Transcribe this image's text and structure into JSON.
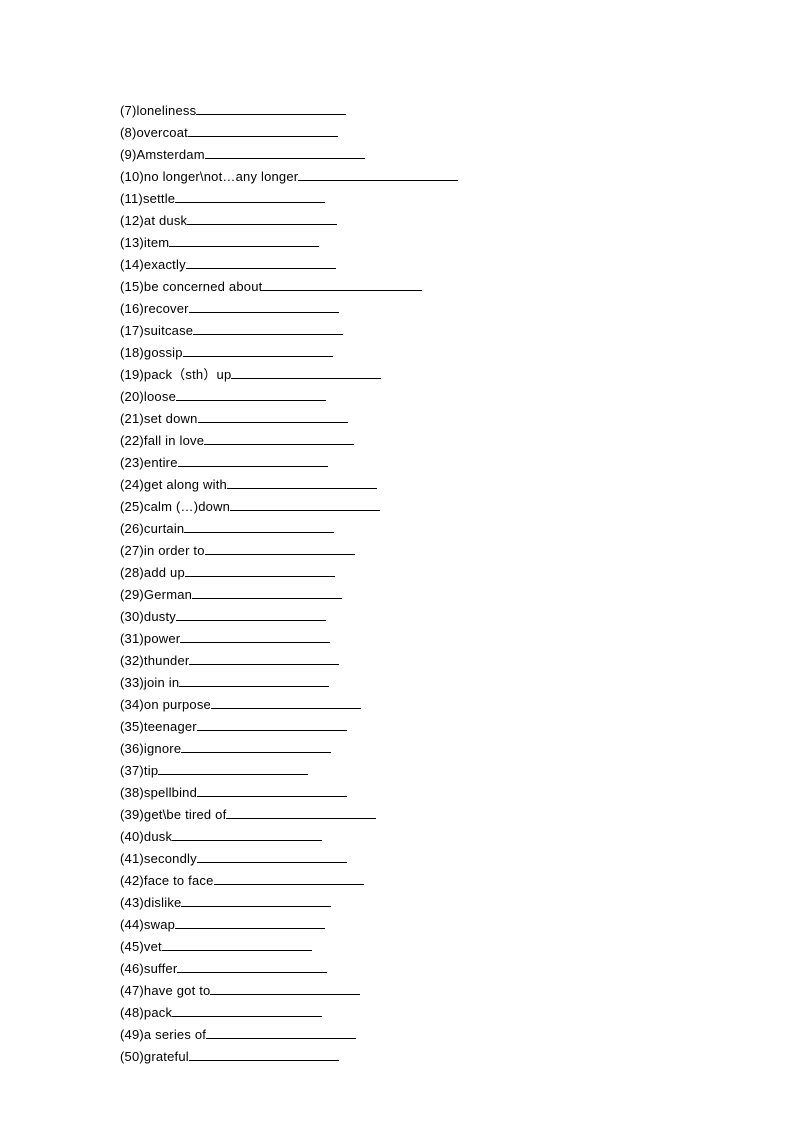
{
  "items": [
    {
      "num": "7",
      "word": "loneliness",
      "blank": "w-med"
    },
    {
      "num": "8",
      "word": "overcoat",
      "blank": "w-med"
    },
    {
      "num": "9",
      "word": "Amsterdam",
      "blank": "w-long"
    },
    {
      "num": "10",
      "word": "no longer\\not…any longer",
      "blank": "w-long"
    },
    {
      "num": "11",
      "word": "settle",
      "blank": "w-med"
    },
    {
      "num": "12",
      "word": "at dusk",
      "blank": "w-med"
    },
    {
      "num": "13",
      "word": "item",
      "blank": "w-med"
    },
    {
      "num": "14",
      "word": "exactly",
      "blank": "w-med"
    },
    {
      "num": "15",
      "word": "be concerned about",
      "blank": "w-long"
    },
    {
      "num": "16",
      "word": "recover",
      "blank": "w-med"
    },
    {
      "num": "17",
      "word": "suitcase",
      "blank": "w-med"
    },
    {
      "num": "18",
      "word": "gossip",
      "blank": "w-med"
    },
    {
      "num": "19",
      "word": "pack（sth）up",
      "blank": "w-med"
    },
    {
      "num": "20",
      "word": "loose",
      "blank": "w-med"
    },
    {
      "num": "21",
      "word": "set down",
      "blank": "w-med"
    },
    {
      "num": "22",
      "word": "fall in love",
      "blank": "w-med"
    },
    {
      "num": "23",
      "word": "entire",
      "blank": "w-med"
    },
    {
      "num": "24",
      "word": "get along with",
      "blank": "w-med"
    },
    {
      "num": "25",
      "word": "calm (…)down",
      "blank": "w-med"
    },
    {
      "num": "26",
      "word": "curtain",
      "blank": "w-med"
    },
    {
      "num": "27",
      "word": "in order to",
      "blank": "w-med"
    },
    {
      "num": "28",
      "word": "add up",
      "blank": "w-med"
    },
    {
      "num": "29",
      "word": "German",
      "blank": "w-med"
    },
    {
      "num": "30",
      "word": "dusty",
      "blank": "w-med"
    },
    {
      "num": "31",
      "word": "power",
      "blank": "w-med"
    },
    {
      "num": "32",
      "word": "thunder",
      "blank": "w-med"
    },
    {
      "num": "33",
      "word": "join in",
      "blank": "w-med"
    },
    {
      "num": "34",
      "word": "on purpose",
      "blank": "w-med"
    },
    {
      "num": "35",
      "word": "teenager",
      "blank": "w-med"
    },
    {
      "num": "36",
      "word": "ignore",
      "blank": "w-med"
    },
    {
      "num": "37",
      "word": "tip",
      "blank": "w-med"
    },
    {
      "num": "38",
      "word": "spellbind",
      "blank": "w-med"
    },
    {
      "num": "39",
      "word": "get\\be tired of",
      "blank": "w-med"
    },
    {
      "num": "40",
      "word": "dusk",
      "blank": "w-med"
    },
    {
      "num": "41",
      "word": "secondly",
      "blank": "w-med"
    },
    {
      "num": "42",
      "word": "face to face",
      "blank": "w-med"
    },
    {
      "num": "43",
      "word": "dislike",
      "blank": "w-med"
    },
    {
      "num": "44",
      "word": "swap",
      "blank": "w-med"
    },
    {
      "num": "45",
      "word": "vet",
      "blank": "w-med"
    },
    {
      "num": "46",
      "word": "suffer",
      "blank": "w-med"
    },
    {
      "num": "47",
      "word": "have got to",
      "blank": "w-med"
    },
    {
      "num": "48",
      "word": "pack",
      "blank": "w-med"
    },
    {
      "num": "49",
      "word": "a series of",
      "blank": "w-med"
    },
    {
      "num": "50",
      "word": "grateful",
      "blank": "w-med"
    }
  ]
}
